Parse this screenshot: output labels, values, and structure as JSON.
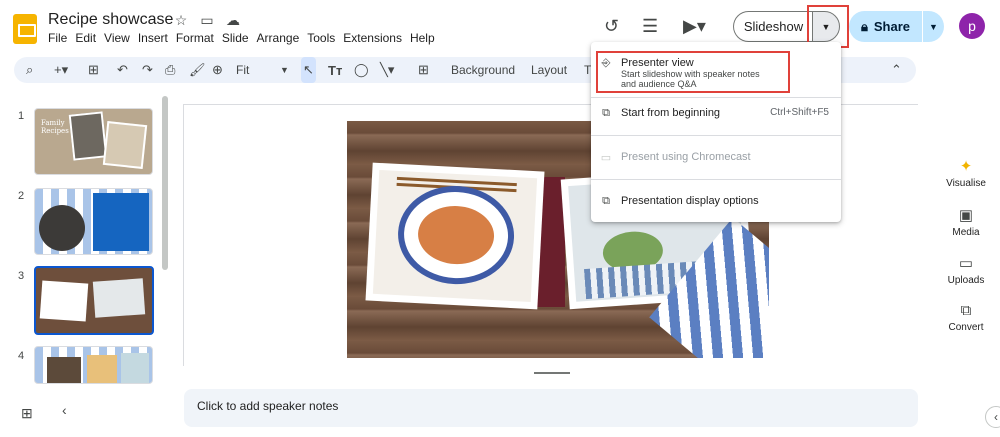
{
  "app": {
    "title": "Recipe showcase",
    "menu": [
      "File",
      "Edit",
      "View",
      "Insert",
      "Format",
      "Slide",
      "Arrange",
      "Tools",
      "Extensions",
      "Help"
    ],
    "accent_color": "#f6b400"
  },
  "header": {
    "slideshow_label": "Slideshow",
    "share_label": "Share",
    "avatar_letter": "p"
  },
  "toolbar": {
    "zoom_label": "Fit",
    "background_label": "Background",
    "layout_label": "Layout",
    "theme_label_partial": "T"
  },
  "filmstrip": {
    "slides": [
      {
        "number": "1",
        "caption": "Family Recipes"
      },
      {
        "number": "2",
        "caption": ""
      },
      {
        "number": "3",
        "caption": ""
      },
      {
        "number": "4",
        "caption": ""
      }
    ],
    "selected_slide": "3"
  },
  "notes": {
    "placeholder": "Click to add speaker notes"
  },
  "side_panel": {
    "items": [
      {
        "label": "Visualise",
        "icon": "sparkle-icon"
      },
      {
        "label": "Media",
        "icon": "media-icon"
      },
      {
        "label": "Uploads",
        "icon": "folder-icon"
      },
      {
        "label": "Convert",
        "icon": "convert-icon"
      }
    ]
  },
  "slideshow_menu": {
    "items": [
      {
        "label": "Presenter view",
        "sublabel_1": "Start slideshow with speaker notes",
        "sublabel_2": "and audience Q&A",
        "icon": "presenter-icon"
      },
      {
        "label": "Start from beginning",
        "shortcut": "Ctrl+Shift+F5",
        "icon": "start-icon"
      },
      {
        "label": "Present using Chromecast",
        "icon": "cast-icon",
        "disabled": true
      },
      {
        "label": "Presentation display options",
        "icon": "display-icon"
      }
    ]
  },
  "highlight_color": "#e0413a"
}
